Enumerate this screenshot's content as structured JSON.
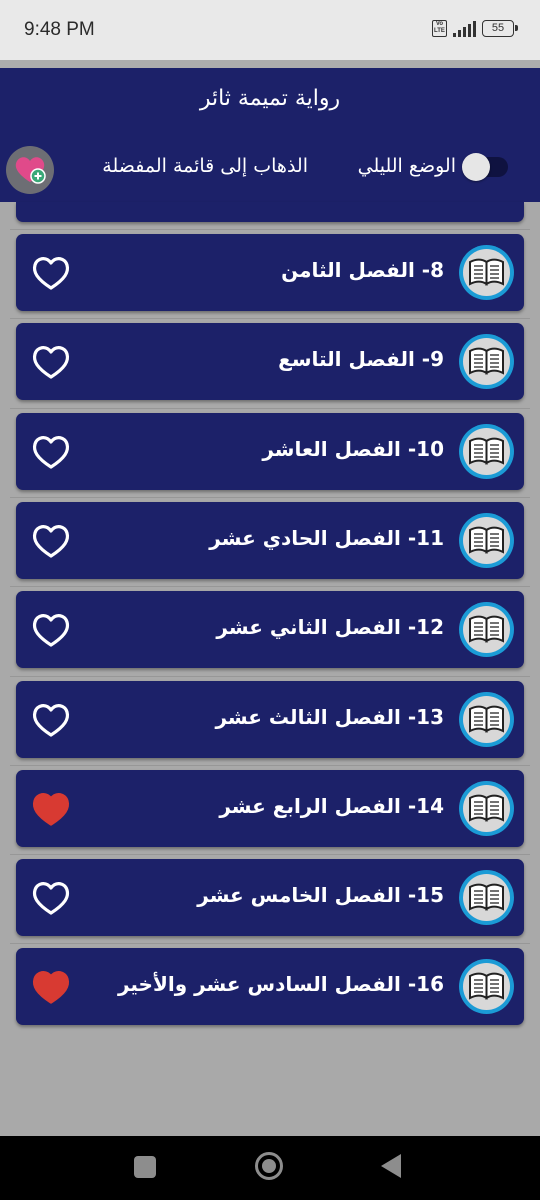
{
  "status_bar": {
    "time": "9:48 PM",
    "volte": "Vo LTE",
    "battery": "55"
  },
  "header": {
    "title": "رواية تميمة ثائر",
    "night_mode_label": "الوضع الليلي",
    "night_mode_on": false,
    "favorites_label": "الذهاب إلى قائمة المفضلة",
    "favorites_icon": "heart-plus-icon"
  },
  "chapters": [
    {
      "title": "8- الفصل الثامن",
      "favorite": false
    },
    {
      "title": "9- الفصل التاسع",
      "favorite": false
    },
    {
      "title": "10- الفصل العاشر",
      "favorite": false
    },
    {
      "title": "11- الفصل الحادي عشر",
      "favorite": false
    },
    {
      "title": "12- الفصل الثاني عشر",
      "favorite": false
    },
    {
      "title": "13- الفصل الثالث عشر",
      "favorite": false
    },
    {
      "title": "14- الفصل الرابع عشر",
      "favorite": true
    },
    {
      "title": "15- الفصل الخامس عشر",
      "favorite": false
    },
    {
      "title": "16- الفصل السادس عشر والأخير",
      "favorite": true
    }
  ],
  "colors": {
    "header_bg": "#1c2169",
    "card_bg": "#1c2169",
    "favorite_heart": "#d83a32",
    "empty_heart": "#ffffff",
    "book_ring": "#1b9bd6"
  },
  "icons": {
    "chapter": "book-icon",
    "favorite": "heart-icon"
  },
  "nav_bar": {
    "recents": "square-icon",
    "home": "circle-home-icon",
    "back": "triangle-back-icon"
  }
}
